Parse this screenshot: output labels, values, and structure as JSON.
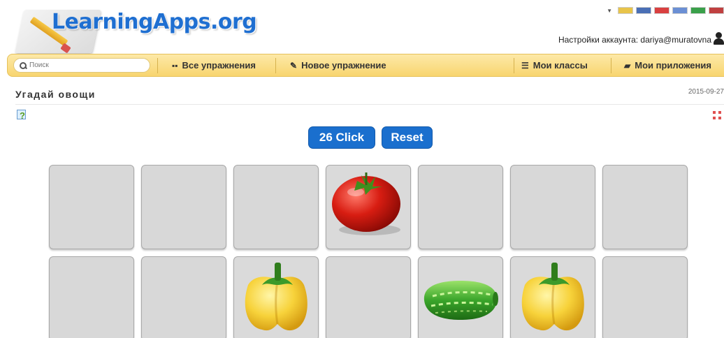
{
  "header": {
    "logo_text": "LearningApps.org",
    "account_label": "Настройки аккаунта: dariya@muratovna",
    "flags": [
      "#e8c44a",
      "#4a6fb5",
      "#d94040",
      "#6b8fd4",
      "#3aa04a",
      "#c04040"
    ]
  },
  "nav": {
    "search_placeholder": "Поиск",
    "items": [
      {
        "label": "Все упражнения",
        "icon": "grid-icon"
      },
      {
        "label": "Новое упражнение",
        "icon": "pencil-icon"
      },
      {
        "label": "Мои классы",
        "icon": "list-icon"
      },
      {
        "label": "Мои приложения",
        "icon": "folder-icon"
      }
    ]
  },
  "app": {
    "title": "Угадай овощи",
    "date": "2015-09-27"
  },
  "game": {
    "click_label": "26 Click",
    "reset_label": "Reset",
    "cards": [
      {
        "row": 1,
        "content": "hidden"
      },
      {
        "row": 1,
        "content": "hidden"
      },
      {
        "row": 1,
        "content": "hidden"
      },
      {
        "row": 1,
        "content": "tomato"
      },
      {
        "row": 1,
        "content": "hidden"
      },
      {
        "row": 1,
        "content": "hidden"
      },
      {
        "row": 1,
        "content": "hidden"
      },
      {
        "row": 2,
        "content": "hidden"
      },
      {
        "row": 2,
        "content": "hidden"
      },
      {
        "row": 2,
        "content": "yellow-pepper"
      },
      {
        "row": 2,
        "content": "hidden"
      },
      {
        "row": 2,
        "content": "cucumber"
      },
      {
        "row": 2,
        "content": "yellow-pepper"
      },
      {
        "row": 2,
        "content": "hidden"
      }
    ]
  },
  "colors": {
    "accent": "#1a6fce",
    "nav_bg": "#f8d56f",
    "card_bg": "#d8d8d8"
  }
}
